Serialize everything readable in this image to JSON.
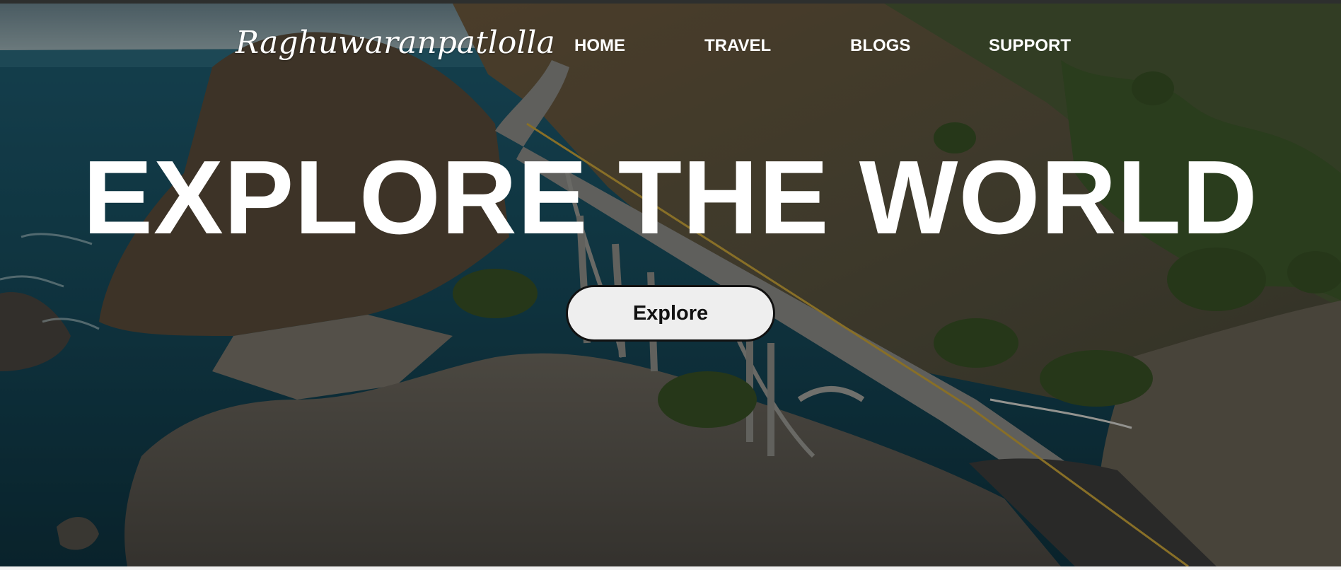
{
  "brand": {
    "logo_text": "Raghuwaranpatlolla"
  },
  "nav": {
    "items": [
      {
        "label": "HOME"
      },
      {
        "label": "TRAVEL"
      },
      {
        "label": "BLOGS"
      },
      {
        "label": "SUPPORT"
      }
    ]
  },
  "hero": {
    "headline": "EXPLORE THE WORLD",
    "cta_label": "Explore",
    "background_description_icon": "coastal-bridge-photo"
  },
  "colors": {
    "nav_text": "#ffffff",
    "headline_text": "#ffffff",
    "button_bg": "#eeeeee",
    "button_border": "#111111",
    "button_text": "#111111",
    "overlay": "#000000"
  }
}
